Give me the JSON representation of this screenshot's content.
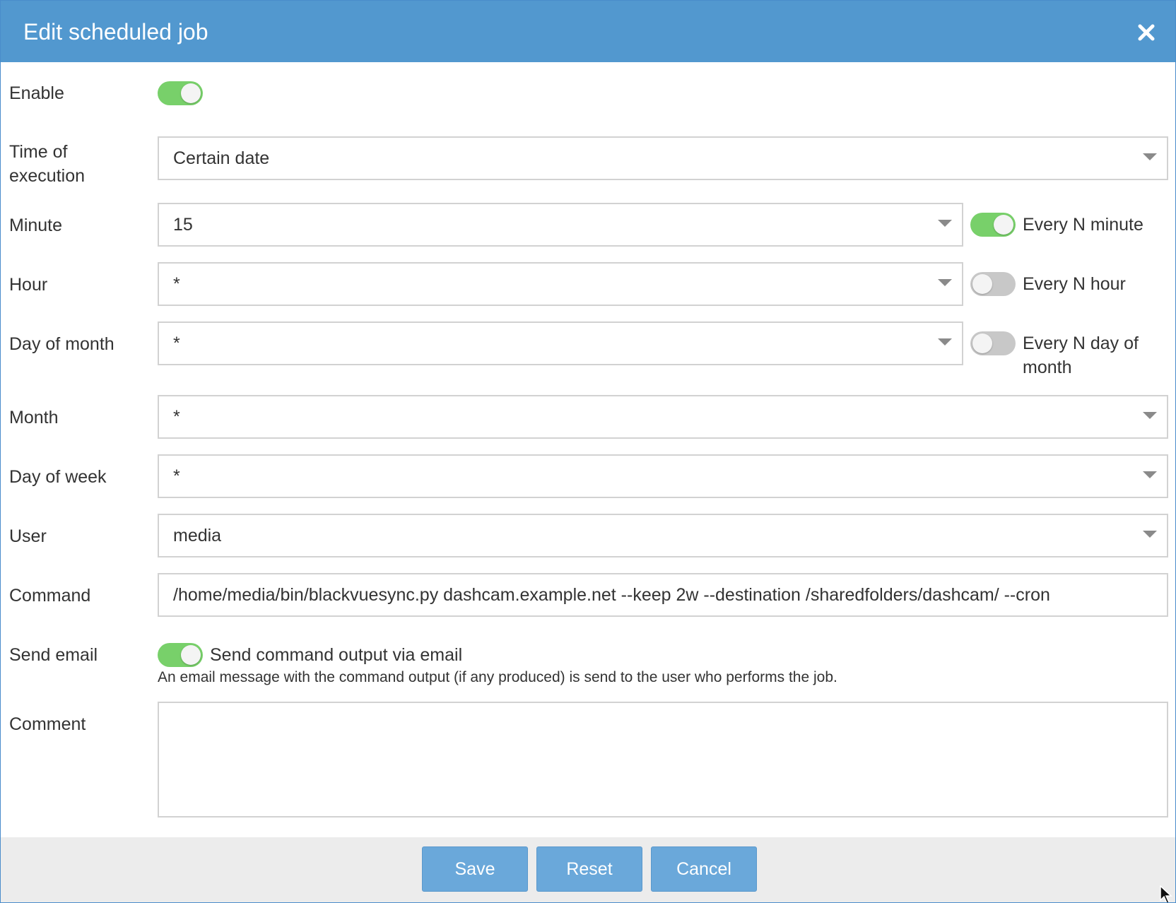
{
  "dialog": {
    "title": "Edit scheduled job",
    "close_icon": "close-icon"
  },
  "fields": {
    "enable": {
      "label": "Enable",
      "on": true
    },
    "time_of_execution": {
      "label": "Time of execution",
      "value": "Certain date"
    },
    "minute": {
      "label": "Minute",
      "value": "15",
      "every_label": "Every N minute",
      "every_on": true
    },
    "hour": {
      "label": "Hour",
      "value": "*",
      "every_label": "Every N hour",
      "every_on": false
    },
    "day_of_month": {
      "label": "Day of month",
      "value": "*",
      "every_label": "Every N day of month",
      "every_on": false
    },
    "month": {
      "label": "Month",
      "value": "*"
    },
    "day_of_week": {
      "label": "Day of week",
      "value": "*"
    },
    "user": {
      "label": "User",
      "value": "media"
    },
    "command": {
      "label": "Command",
      "value": "/home/media/bin/blackvuesync.py dashcam.example.net --keep 2w --destination /sharedfolders/dashcam/ --cron"
    },
    "send_email": {
      "label": "Send email",
      "on": true,
      "toggle_label": "Send command output via email",
      "help": "An email message with the command output (if any produced) is send to the user who performs the job."
    },
    "comment": {
      "label": "Comment",
      "value": ""
    }
  },
  "buttons": {
    "save": "Save",
    "reset": "Reset",
    "cancel": "Cancel"
  },
  "colors": {
    "titlebar": "#5298cf",
    "toggle_on": "#78d06a",
    "toggle_off": "#c8c8c8",
    "button": "#6aa8da"
  }
}
